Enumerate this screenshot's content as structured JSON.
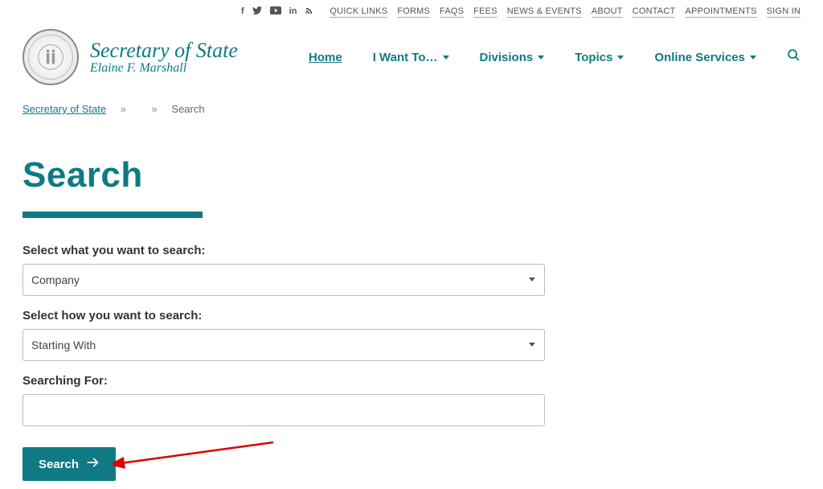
{
  "topbar": {
    "links": [
      "QUICK LINKS",
      "FORMS",
      "FAQS",
      "FEES",
      "NEWS & EVENTS",
      "ABOUT",
      "CONTACT",
      "APPOINTMENTS",
      "SIGN IN"
    ]
  },
  "brand": {
    "line1": "Secretary of State",
    "line2": "Elaine F. Marshall"
  },
  "nav": {
    "home": "Home",
    "iwant": "I Want To…",
    "divisions": "Divisions",
    "topics": "Topics",
    "online": "Online Services"
  },
  "breadcrumb": {
    "root": "Secretary of State",
    "current": "Search"
  },
  "page": {
    "title": "Search",
    "label_what": "Select what you want to search:",
    "select_what_value": "Company",
    "label_how": "Select how you want to search:",
    "select_how_value": "Starting With",
    "label_for": "Searching For:",
    "input_for_value": "",
    "button": "Search"
  }
}
